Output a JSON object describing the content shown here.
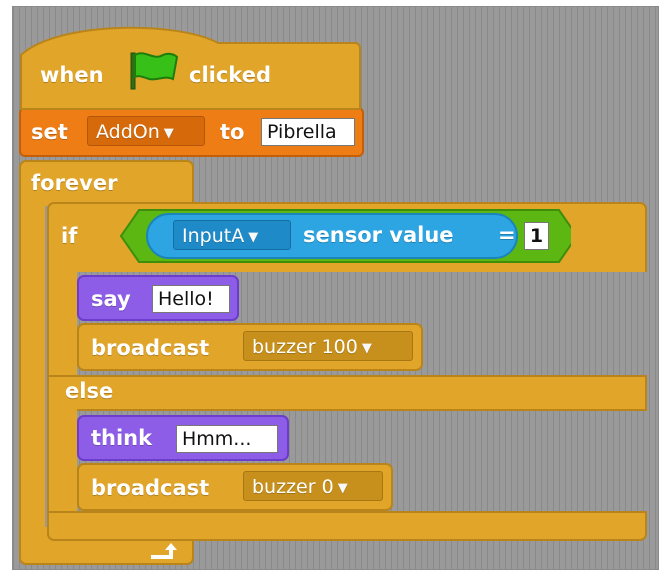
{
  "script": {
    "hat": {
      "when": "when",
      "clicked": "clicked",
      "flag_icon": "green-flag-icon"
    },
    "set": {
      "label": "set",
      "variable": "AddOn",
      "to": "to",
      "value": "Pibrella"
    },
    "forever": {
      "label": "forever",
      "loop_icon": "loop-arrow-icon"
    },
    "if_block": {
      "if": "if",
      "else": "else",
      "condition": {
        "sensor": "InputA",
        "sensor_label": "sensor value",
        "operator": "=",
        "value": "1"
      }
    },
    "then_blocks": {
      "say_label": "say",
      "say_value": "Hello!",
      "broadcast_label": "broadcast",
      "broadcast_value": "buzzer 100"
    },
    "else_blocks": {
      "think_label": "think",
      "think_value": "Hmm...",
      "broadcast_label": "broadcast",
      "broadcast_value": "buzzer 0"
    }
  },
  "colors": {
    "control": "#e1a52a",
    "data": "#ee7d16",
    "looks": "#8d5de8",
    "sensing": "#2ca5e2",
    "operators": "#5cb712",
    "background": "#9a9a9a"
  }
}
